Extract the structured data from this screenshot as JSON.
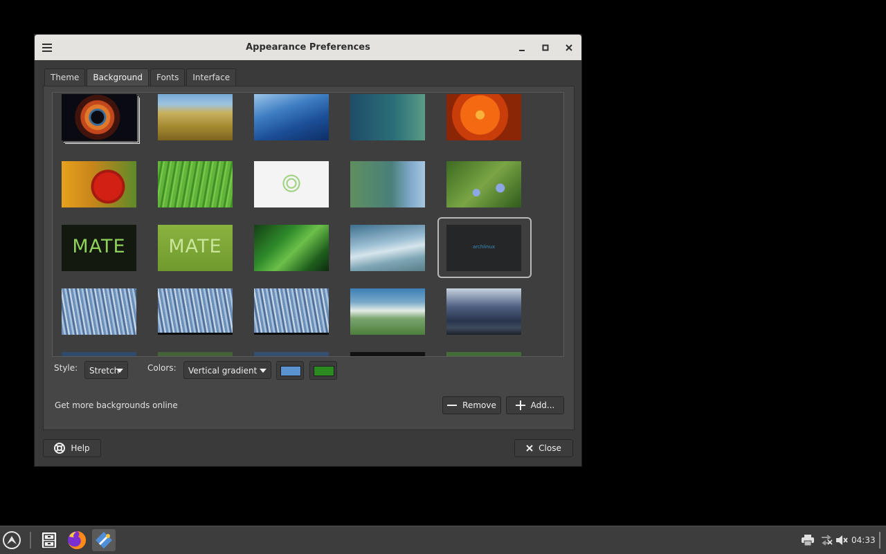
{
  "window": {
    "title": "Appearance Preferences"
  },
  "tabs": [
    {
      "label": "Theme"
    },
    {
      "label": "Background"
    },
    {
      "label": "Fonts"
    },
    {
      "label": "Interface"
    }
  ],
  "active_tab": "Background",
  "wallpaper_thumbs": [
    {
      "id": "helix-nebula"
    },
    {
      "id": "beach-grass"
    },
    {
      "id": "blue-waves"
    },
    {
      "id": "teal-bubbles"
    },
    {
      "id": "orange-flower"
    },
    {
      "id": "red-flower"
    },
    {
      "id": "green-grass"
    },
    {
      "id": "mate-logo-white"
    },
    {
      "id": "green-blue-gradient"
    },
    {
      "id": "blue-flowers"
    },
    {
      "id": "mate-dark",
      "text": "MATE"
    },
    {
      "id": "mate-green",
      "text": "MATE"
    },
    {
      "id": "green-leaves"
    },
    {
      "id": "blue-swirl"
    },
    {
      "id": "archlinux-dark",
      "text": "archlinux"
    },
    {
      "id": "abstract-blue-1"
    },
    {
      "id": "abstract-blue-2"
    },
    {
      "id": "abstract-blue-3"
    },
    {
      "id": "green-horizon"
    },
    {
      "id": "stormy-sky"
    }
  ],
  "selected_thumb": "archlinux-dark",
  "style": {
    "label": "Style:",
    "value": "Stretch"
  },
  "colors": {
    "label": "Colors:",
    "value": "Vertical gradient",
    "primary": "#5a93cf",
    "secondary": "#2b8b21"
  },
  "link_text": "Get more backgrounds online",
  "buttons": {
    "remove": "Remove",
    "add": "Add...",
    "help": "Help",
    "close": "Close"
  },
  "taskbar": {
    "clock": "04:33"
  }
}
